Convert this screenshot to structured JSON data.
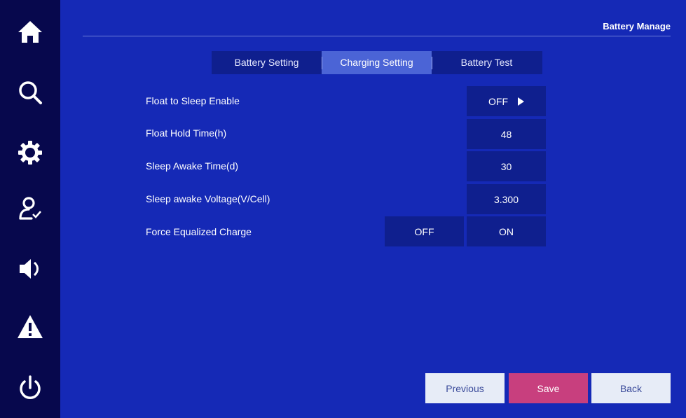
{
  "header": {
    "title": "Battery Manage"
  },
  "sidebar": {
    "items": [
      {
        "name": "home",
        "icon": "home-icon"
      },
      {
        "name": "search",
        "icon": "search-icon"
      },
      {
        "name": "settings",
        "icon": "gear-icon"
      },
      {
        "name": "user",
        "icon": "user-check-icon"
      },
      {
        "name": "sound",
        "icon": "speaker-icon"
      },
      {
        "name": "alarm",
        "icon": "warning-icon"
      },
      {
        "name": "power",
        "icon": "power-icon"
      }
    ]
  },
  "tabs": [
    {
      "label": "Battery Setting"
    },
    {
      "label": "Charging Setting",
      "active": true
    },
    {
      "label": "Battery Test"
    }
  ],
  "settings": {
    "rows": [
      {
        "label": "Float to Sleep Enable",
        "value": "OFF"
      },
      {
        "label": "Float Hold Time(h)",
        "value": "48"
      },
      {
        "label": "Sleep Awake Time(d)",
        "value": "30"
      },
      {
        "label": "Sleep awake Voltage(V/Cell)",
        "value": "3.300"
      }
    ],
    "force_equalized": {
      "label": "Force Equalized Charge",
      "off_label": "OFF",
      "on_label": "ON"
    }
  },
  "buttons": {
    "previous": "Previous",
    "save": "Save",
    "back": "Back"
  },
  "colors": {
    "sidebar": "#07084d",
    "main_bg": "#1529b6",
    "box_bg": "#0f1f8e",
    "tab_active": "#4b64d6",
    "save": "#c83f7e"
  }
}
